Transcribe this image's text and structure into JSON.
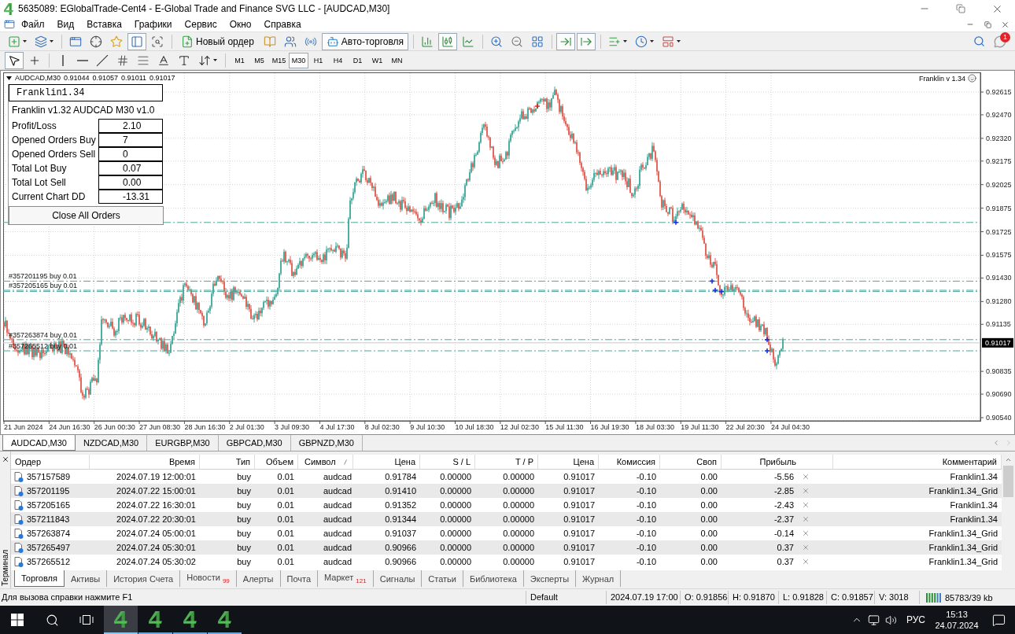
{
  "window": {
    "title": "5635089: EGlobalTrade-Cent4 - E-Global Trade and Finance SVG LLC - [AUDCAD,M30]"
  },
  "menu": [
    "Файл",
    "Вид",
    "Вставка",
    "Графики",
    "Сервис",
    "Окно",
    "Справка"
  ],
  "toolbar_main": [
    [
      {
        "kind": "icon",
        "pressed": false,
        "dropdown": true
      },
      {
        "kind": "icon",
        "pressed": false,
        "dropdown": true
      }
    ],
    [
      {
        "kind": "icon",
        "pressed": false,
        "dropdown": false
      },
      {
        "kind": "icon",
        "pressed": false,
        "dropdown": false
      },
      {
        "kind": "icon",
        "pressed": false,
        "dropdown": false
      },
      {
        "kind": "icon",
        "pressed": true,
        "dropdown": false
      },
      {
        "kind": "icon",
        "pressed": false,
        "dropdown": false
      }
    ],
    [
      {
        "kind": "text",
        "label": "Новый ордер",
        "pressed": false,
        "dropdown": false
      },
      {
        "kind": "icon",
        "pressed": false,
        "dropdown": false
      },
      {
        "kind": "icon",
        "pressed": false,
        "dropdown": false
      },
      {
        "kind": "icon",
        "pressed": false,
        "dropdown": false
      },
      {
        "kind": "text",
        "label": "Авто-торговля",
        "pressed": true,
        "dropdown": false
      }
    ],
    [
      {
        "kind": "icon",
        "pressed": false,
        "dropdown": false
      },
      {
        "kind": "icon",
        "pressed": true,
        "dropdown": false
      },
      {
        "kind": "icon",
        "pressed": false,
        "dropdown": false
      }
    ],
    [
      {
        "kind": "icon",
        "pressed": false,
        "dropdown": false
      },
      {
        "kind": "icon",
        "pressed": false,
        "dropdown": false
      },
      {
        "kind": "icon",
        "pressed": false,
        "dropdown": false
      }
    ],
    [
      {
        "kind": "icon",
        "pressed": true,
        "dropdown": false
      },
      {
        "kind": "icon",
        "pressed": true,
        "dropdown": false
      }
    ],
    [
      {
        "kind": "icon",
        "pressed": false,
        "dropdown": true
      },
      {
        "kind": "icon",
        "pressed": false,
        "dropdown": true
      },
      {
        "kind": "icon",
        "pressed": false,
        "dropdown": true
      }
    ]
  ],
  "toolbar_tools": [
    [
      {
        "kind": "icon",
        "pressed": true,
        "dropdown": false
      },
      {
        "kind": "icon",
        "pressed": false,
        "dropdown": false
      }
    ],
    [
      {
        "kind": "icon",
        "pressed": false,
        "dropdown": false
      },
      {
        "kind": "icon",
        "pressed": false,
        "dropdown": false
      },
      {
        "kind": "icon",
        "pressed": false,
        "dropdown": false
      },
      {
        "kind": "icon",
        "pressed": false,
        "dropdown": false
      },
      {
        "kind": "icon",
        "pressed": false,
        "dropdown": false
      },
      {
        "kind": "icon",
        "pressed": false,
        "dropdown": false
      },
      {
        "kind": "icon",
        "pressed": false,
        "dropdown": false
      },
      {
        "kind": "icon",
        "pressed": false,
        "dropdown": true
      }
    ]
  ],
  "timeframes": [
    {
      "label": "M1",
      "selected": false
    },
    {
      "label": "M5",
      "selected": false
    },
    {
      "label": "M15",
      "selected": false
    },
    {
      "label": "M30",
      "selected": true
    },
    {
      "label": "H1",
      "selected": false
    },
    {
      "label": "H4",
      "selected": false
    },
    {
      "label": "D1",
      "selected": false
    },
    {
      "label": "W1",
      "selected": false
    },
    {
      "label": "MN",
      "selected": false
    }
  ],
  "notifications": {
    "count": "1"
  },
  "chart": {
    "symbol": "AUDCAD,M30",
    "ohlc": [
      "0.91044",
      "0.91057",
      "0.91011",
      "0.91017"
    ],
    "ea_label": "Franklin v 1.34",
    "price_ticks": [
      "0.92615",
      "0.92470",
      "0.92320",
      "0.92175",
      "0.92025",
      "0.91875",
      "0.91725",
      "0.91575",
      "0.91430",
      "0.91280",
      "0.91135",
      "0.90835",
      "0.90690",
      "0.90540"
    ],
    "price_tag": "0.91017",
    "time_labels": [
      "21 Jun 2024",
      "24 Jun 16:30",
      "26 Jun 00:30",
      "27 Jun 08:30",
      "28 Jun 16:30",
      "2 Jul 01:30",
      "3 Jul 09:30",
      "4 Jul 17:30",
      "8 Jul 02:30",
      "9 Jul 10:30",
      "10 Jul 18:30",
      "12 Jul 02:30",
      "15 Jul 11:30",
      "16 Jul 19:30",
      "18 Jul 03:30",
      "19 Jul 11:30",
      "22 Jul 20:30",
      "24 Jul 04:30"
    ],
    "order_labels": [
      "#357201195 buy 0.01",
      "#357205165 buy 0.01",
      "#357263874 buy 0.01",
      "#357265512 buy 0.01"
    ]
  },
  "expert_panel": {
    "title": "Franklin1.34",
    "subtitle": "Franklin v1.32 AUDCAD M30 v1.0",
    "rows": [
      {
        "label": "Profit/Loss",
        "value": "2.10"
      },
      {
        "label": "Opened Orders Buy",
        "value": "7"
      },
      {
        "label": "Opened Orders Sell",
        "value": "0"
      },
      {
        "label": "Total Lot Buy",
        "value": "0.07"
      },
      {
        "label": "Total Lot Sell",
        "value": "0.00"
      },
      {
        "label": "Current Chart DD",
        "value": "-13.31"
      }
    ],
    "button": "Close All Orders"
  },
  "chart_tabs": [
    {
      "label": "AUDCAD,M30",
      "selected": true
    },
    {
      "label": "NZDCAD,M30",
      "selected": false
    },
    {
      "label": "EURGBP,M30",
      "selected": false
    },
    {
      "label": "GBPCAD,M30",
      "selected": false
    },
    {
      "label": "GBPNZD,M30",
      "selected": false
    }
  ],
  "terminal": {
    "label": "Терминал",
    "columns": [
      {
        "label": "Ордер",
        "sorted": false
      },
      {
        "label": "Время",
        "sorted": false
      },
      {
        "label": "Тип",
        "sorted": false
      },
      {
        "label": "Объем",
        "sorted": false
      },
      {
        "label": "Символ",
        "sorted": true
      },
      {
        "label": "Цена",
        "sorted": false
      },
      {
        "label": "S / L",
        "sorted": false
      },
      {
        "label": "T / P",
        "sorted": false
      },
      {
        "label": "Цена",
        "sorted": false
      },
      {
        "label": "Комиссия",
        "sorted": false
      },
      {
        "label": "Своп",
        "sorted": false
      },
      {
        "label": "Прибыль",
        "sorted": false
      },
      {
        "label": "Комментарий",
        "sorted": false
      }
    ],
    "rows": [
      {
        "cells": [
          "357157589",
          "2024.07.19 12:00:01",
          "buy",
          "0.01",
          "audcad",
          "0.91784",
          "0.00000",
          "0.00000",
          "0.91017",
          "-0.10",
          "0.00",
          "-5.56",
          "Franklin1.34"
        ]
      },
      {
        "cells": [
          "357201195",
          "2024.07.22 15:00:01",
          "buy",
          "0.01",
          "audcad",
          "0.91410",
          "0.00000",
          "0.00000",
          "0.91017",
          "-0.10",
          "0.00",
          "-2.85",
          "Franklin1.34_Grid"
        ]
      },
      {
        "cells": [
          "357205165",
          "2024.07.22 16:30:01",
          "buy",
          "0.01",
          "audcad",
          "0.91352",
          "0.00000",
          "0.00000",
          "0.91017",
          "-0.10",
          "0.00",
          "-2.43",
          "Franklin1.34"
        ]
      },
      {
        "cells": [
          "357211843",
          "2024.07.22 20:30:01",
          "buy",
          "0.01",
          "audcad",
          "0.91344",
          "0.00000",
          "0.00000",
          "0.91017",
          "-0.10",
          "0.00",
          "-2.37",
          "Franklin1.34"
        ]
      },
      {
        "cells": [
          "357263874",
          "2024.07.24 05:00:01",
          "buy",
          "0.01",
          "audcad",
          "0.91037",
          "0.00000",
          "0.00000",
          "0.91017",
          "-0.10",
          "0.00",
          "-0.14",
          "Franklin1.34_Grid"
        ]
      },
      {
        "cells": [
          "357265497",
          "2024.07.24 05:30:01",
          "buy",
          "0.01",
          "audcad",
          "0.90966",
          "0.00000",
          "0.00000",
          "0.91017",
          "-0.10",
          "0.00",
          "0.37",
          "Franklin1.34_Grid"
        ]
      },
      {
        "cells": [
          "357265512",
          "2024.07.24 05:30:02",
          "buy",
          "0.01",
          "audcad",
          "0.90966",
          "0.00000",
          "0.00000",
          "0.91017",
          "-0.10",
          "0.00",
          "0.37",
          "Franklin1.34_Grid"
        ]
      }
    ],
    "tabs": [
      {
        "label": "Торговля",
        "selected": true
      },
      {
        "label": "Активы",
        "selected": false
      },
      {
        "label": "История Счета",
        "selected": false
      },
      {
        "label": "Новости",
        "badge": "99",
        "selected": false
      },
      {
        "label": "Алерты",
        "selected": false
      },
      {
        "label": "Почта",
        "selected": false
      },
      {
        "label": "Маркет",
        "badge": "121",
        "selected": false
      },
      {
        "label": "Сигналы",
        "selected": false
      },
      {
        "label": "Статьи",
        "selected": false
      },
      {
        "label": "Библиотека",
        "selected": false
      },
      {
        "label": "Эксперты",
        "selected": false
      },
      {
        "label": "Журнал",
        "selected": false
      }
    ]
  },
  "status_bar": {
    "cells": [
      "Для вызова справки нажмите F1",
      "Default",
      "2024.07.19 17:00",
      "O: 0.91856",
      "H: 0.91870",
      "L: 0.91828",
      "C: 0.91857",
      "V: 3018"
    ],
    "connection": "85783/39 kb"
  },
  "taskbar": {
    "apps": [
      {
        "selected": true
      },
      {
        "selected": false
      },
      {
        "selected": false
      },
      {
        "selected": false
      }
    ],
    "language": "РУС",
    "time": "15:13",
    "date": "24.07.2024"
  }
}
